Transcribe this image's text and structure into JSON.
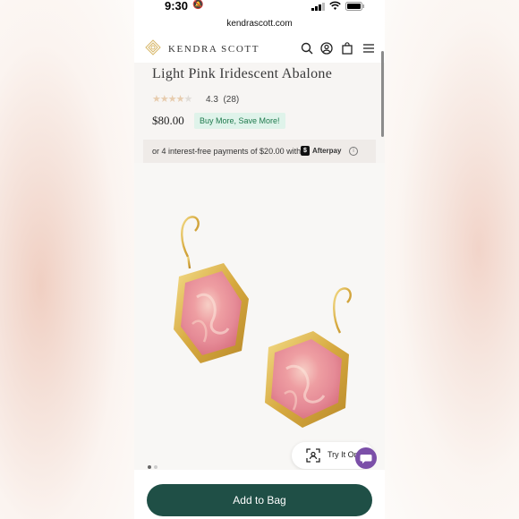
{
  "status_bar": {
    "time": "9:30"
  },
  "browser": {
    "url": "kendrascott.com"
  },
  "header": {
    "brand": "KENDRA SCOTT"
  },
  "product": {
    "title": "Light Pink Iridescent Abalone",
    "rating": "4.3",
    "review_count": "(28)",
    "price": "$80.00",
    "promo": "Buy More, Save More!",
    "stars_filled": 4.3
  },
  "afterpay": {
    "text": "or 4 interest-free payments of $20.00 with",
    "brand": "Afterpay"
  },
  "gallery": {
    "active_index": 0,
    "count": 2
  },
  "actions": {
    "try_on": "Try It On",
    "add_to_bag": "Add to Bag"
  },
  "colors": {
    "add_to_bag_bg": "#1f4f46",
    "promo_bg": "#dff3ea",
    "chat_bg": "#7b4fa8",
    "logo_accent": "#d8b86a"
  },
  "icons": {
    "notification": "bell-slash-icon",
    "search": "search-icon",
    "account": "user-icon",
    "bag": "shopping-bag-icon",
    "menu": "hamburger-menu-icon"
  }
}
